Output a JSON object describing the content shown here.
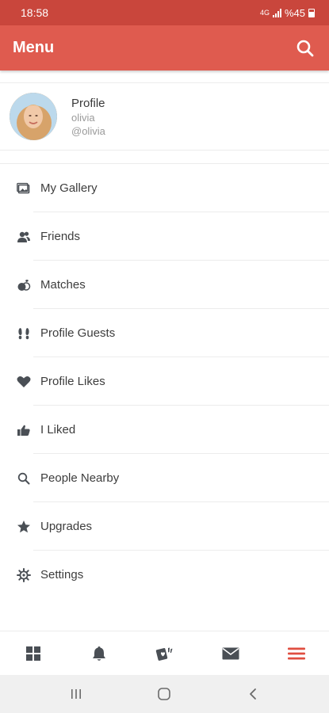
{
  "status_bar": {
    "time": "18:58",
    "battery_text": "%45"
  },
  "app_bar": {
    "title": "Menu"
  },
  "profile": {
    "title": "Profile",
    "name": "olivia",
    "handle": "@olivia"
  },
  "menu": {
    "items": [
      {
        "label": "My Gallery",
        "icon": "gallery-icon"
      },
      {
        "label": "Friends",
        "icon": "friends-icon"
      },
      {
        "label": "Matches",
        "icon": "matches-icon"
      },
      {
        "label": "Profile Guests",
        "icon": "footprints-icon"
      },
      {
        "label": "Profile Likes",
        "icon": "heart-icon"
      },
      {
        "label": "I Liked",
        "icon": "thumbs-up-icon"
      },
      {
        "label": "People Nearby",
        "icon": "search-icon"
      },
      {
        "label": "Upgrades",
        "icon": "star-icon"
      },
      {
        "label": "Settings",
        "icon": "gear-icon"
      }
    ]
  },
  "bottom_nav": [
    {
      "icon": "grid-icon",
      "active": false
    },
    {
      "icon": "bell-icon",
      "active": false
    },
    {
      "icon": "cards-icon",
      "active": false
    },
    {
      "icon": "mail-icon",
      "active": false
    },
    {
      "icon": "hamburger-menu-icon",
      "active": true
    }
  ],
  "colors": {
    "status_bar": "#c9463c",
    "app_bar": "#df5b4f",
    "accent": "#e04e40",
    "icon": "#4a4f55"
  }
}
